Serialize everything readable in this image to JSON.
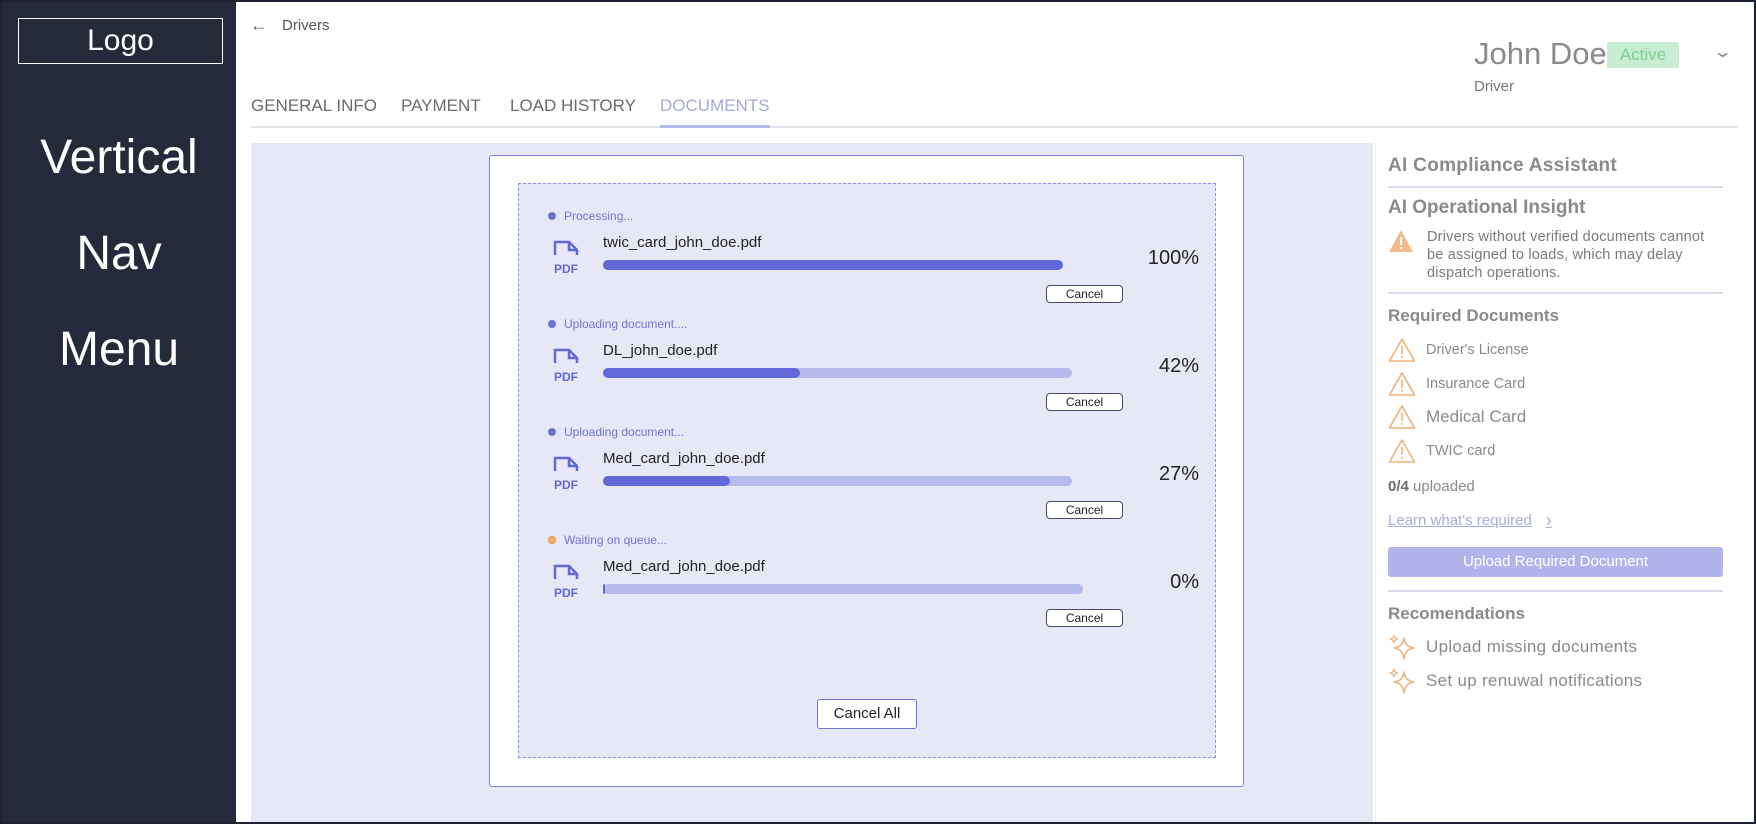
{
  "sidebar": {
    "logo": "Logo",
    "nav_words": [
      "Vertical",
      "Nav",
      "Menu"
    ]
  },
  "header": {
    "breadcrumb": "Drivers",
    "profile": {
      "name": "John Doe",
      "status": "Active",
      "role": "Driver"
    }
  },
  "tabs": [
    {
      "label": "GENERAL INFO",
      "active": false
    },
    {
      "label": "PAYMENT",
      "active": false
    },
    {
      "label": "LOAD HISTORY",
      "active": false
    },
    {
      "label": "DOCUMENTS",
      "active": true
    }
  ],
  "uploads": {
    "items": [
      {
        "status": "Processing...",
        "filename": "twic_card_john_doe.pdf",
        "progress_label": "100%",
        "progress": 100,
        "cancel_label": "Cancel"
      },
      {
        "status": "Uploading document....",
        "filename": "DL_john_doe.pdf",
        "progress_label": "42%",
        "progress": 42,
        "cancel_label": "Cancel"
      },
      {
        "status": "Uploading document...",
        "filename": "Med_card_john_doe.pdf",
        "progress_label": "27%",
        "progress": 27,
        "cancel_label": "Cancel"
      },
      {
        "status": "Waiting on queue...",
        "filename": "Med_card_john_doe.pdf",
        "progress_label": "0%",
        "progress": 0,
        "cancel_label": "Cancel"
      }
    ],
    "icon_label": "PDF",
    "cancel_all_label": "Cancel All"
  },
  "assistant": {
    "title": "AI Compliance Assistant",
    "insight_title": "AI Operational Insight",
    "insight_text": "Drivers without verified documents cannot be assigned to loads, which may delay dispatch operations.",
    "required_title": "Required Documents",
    "required_docs": [
      "Driver's License",
      "Insurance Card",
      "Medical Card",
      "TWIC card"
    ],
    "uploaded_count": "0/4",
    "uploaded_suffix": "uploaded",
    "learn_link": "Learn what's required",
    "upload_button": "Upload Required Document",
    "recommendations_title": "Recomendations",
    "recommendations": [
      "Upload missing documents",
      "Set up renuwal notifications"
    ]
  },
  "colors": {
    "sidebar_bg": "#252a3a",
    "accent": "#6268d9",
    "accent_light": "#b6b9ee",
    "warning": "#f0b07a",
    "active_badge_bg": "#c8ecd4",
    "active_badge_text": "#7fcf98"
  },
  "icons": {
    "back": "arrow-left-icon",
    "dropdown": "chevron-down-icon",
    "file": "pdf-file-icon",
    "warning": "warning-triangle-icon",
    "sparkle": "sparkle-icon",
    "link_chevron": "chevron-right-icon"
  }
}
